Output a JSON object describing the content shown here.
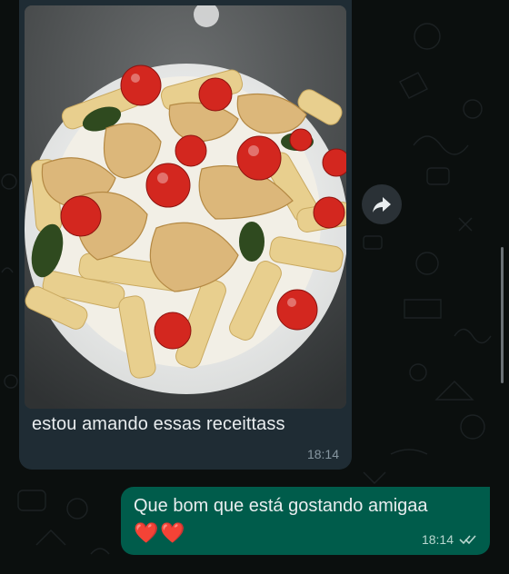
{
  "incoming": {
    "text": "estou amando essas receittass",
    "time": "18:14",
    "photo_description": "pasta-with-chicken-and-tomatoes"
  },
  "outgoing": {
    "text": "Que bom que está gostando amigaa",
    "emoji": "❤️❤️",
    "time": "18:14",
    "status": "read"
  },
  "colors": {
    "chat_background": "#0b0f0e",
    "incoming_bubble": "#1f2c34",
    "outgoing_bubble": "#005c4b",
    "read_ticks": "#b8d7cf"
  },
  "icons": {
    "forward": "forward-arrow-icon",
    "ticks": "double-check-icon"
  }
}
